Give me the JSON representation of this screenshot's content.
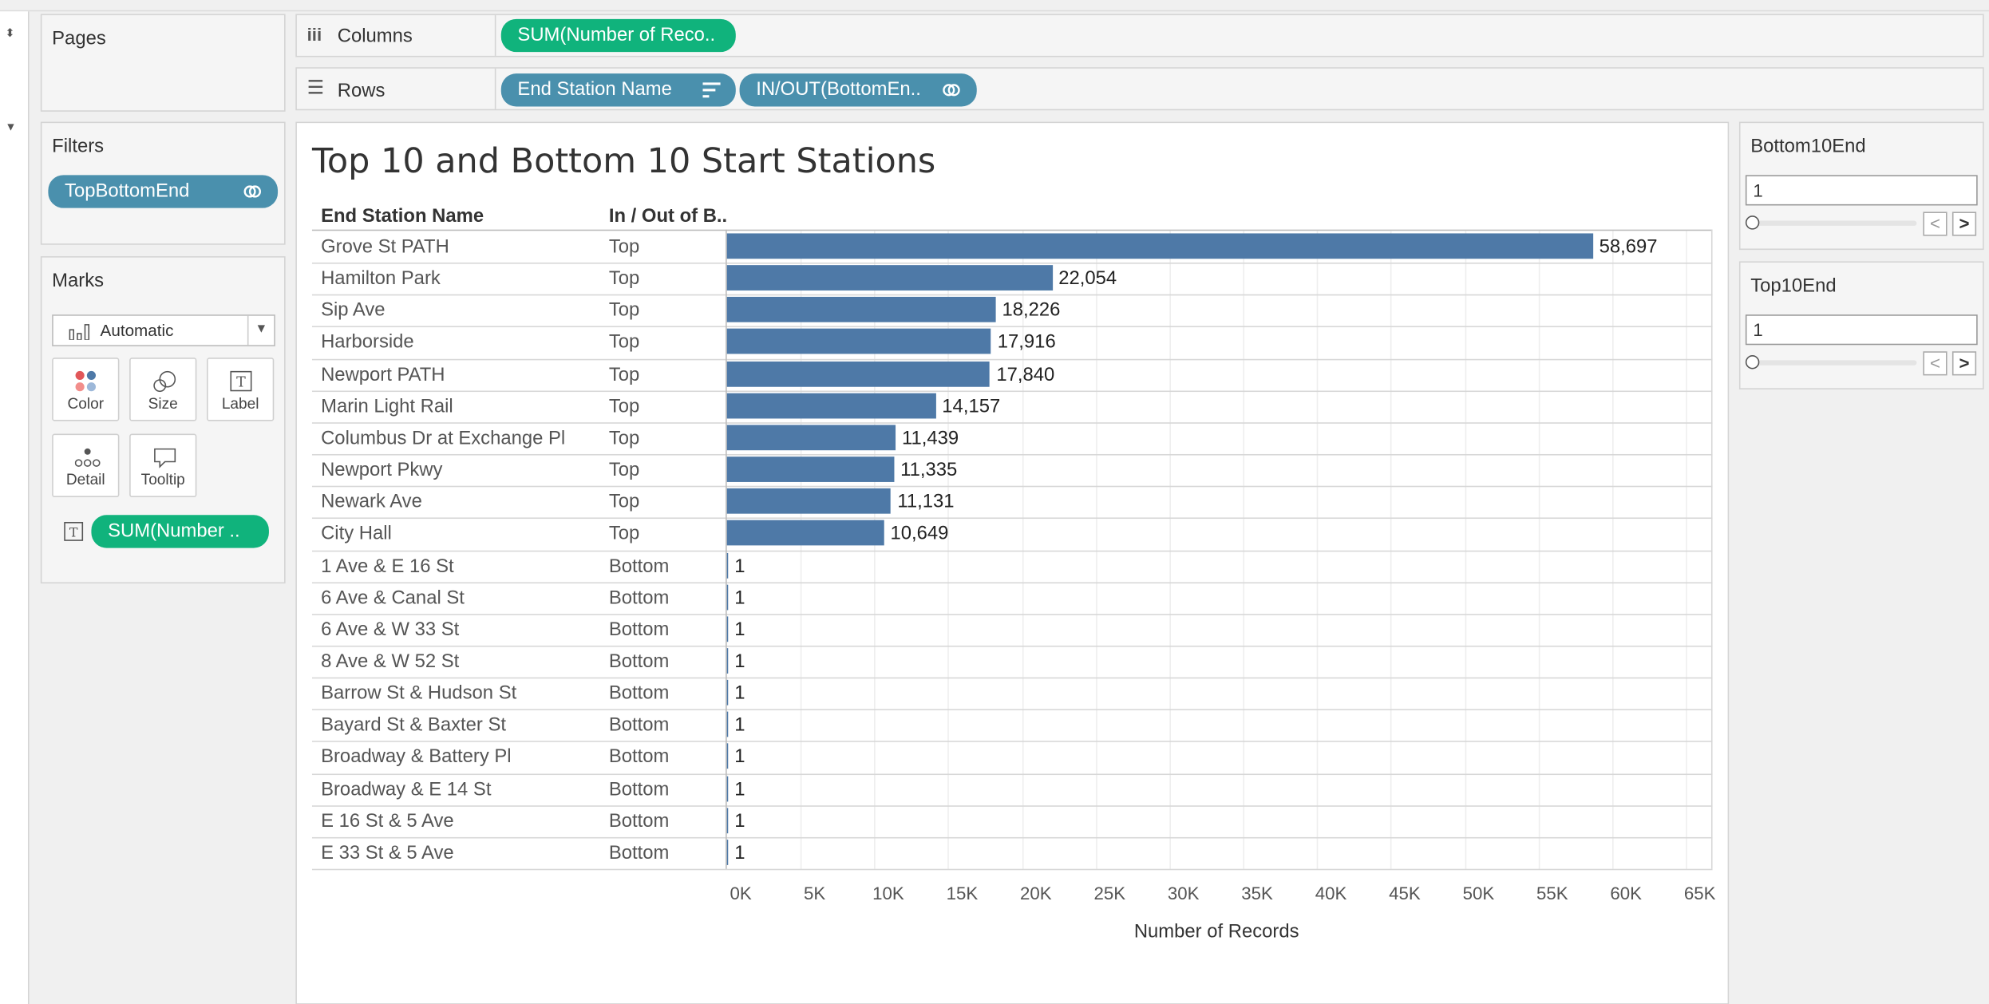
{
  "shelves": {
    "pages_title": "Pages",
    "columns_label": "Columns",
    "columns_pill": "SUM(Number of Reco..",
    "rows_label": "Rows",
    "rows_pills": [
      "End Station Name",
      "IN/OUT(BottomEn.."
    ]
  },
  "filters": {
    "title": "Filters",
    "pill": "TopBottomEnd"
  },
  "marks": {
    "title": "Marks",
    "type_select": "Automatic",
    "buttons": [
      "Color",
      "Size",
      "Label",
      "Detail",
      "Tooltip"
    ],
    "label_pill": "SUM(Number .."
  },
  "parameters": [
    {
      "title": "Bottom10End",
      "value": "1"
    },
    {
      "title": "Top10End",
      "value": "1"
    }
  ],
  "chart_data": {
    "type": "bar",
    "title": "Top 10 and Bottom 10 Start Stations",
    "row_headers": [
      "End Station Name",
      "In / Out of B.."
    ],
    "xlabel": "Number of Records",
    "xlim": [
      0,
      65000
    ],
    "ticks": [
      "0K",
      "5K",
      "10K",
      "15K",
      "20K",
      "25K",
      "30K",
      "35K",
      "40K",
      "45K",
      "50K",
      "55K",
      "60K",
      "65K"
    ],
    "bar_color": "#4e79a7",
    "categories": [
      "Grove St PATH",
      "Hamilton Park",
      "Sip Ave",
      "Harborside",
      "Newport PATH",
      "Marin Light Rail",
      "Columbus Dr at Exchange Pl",
      "Newport Pkwy",
      "Newark Ave",
      "City Hall",
      "1 Ave & E 16 St",
      "6 Ave & Canal St",
      "6 Ave & W 33 St",
      "8 Ave & W 52 St",
      "Barrow St & Hudson St",
      "Bayard St & Baxter St",
      "Broadway & Battery Pl",
      "Broadway & E 14 St",
      "E 16 St & 5 Ave",
      "E 33 St & 5 Ave"
    ],
    "groups": [
      "Top",
      "Top",
      "Top",
      "Top",
      "Top",
      "Top",
      "Top",
      "Top",
      "Top",
      "Top",
      "Bottom",
      "Bottom",
      "Bottom",
      "Bottom",
      "Bottom",
      "Bottom",
      "Bottom",
      "Bottom",
      "Bottom",
      "Bottom"
    ],
    "values": [
      58697,
      22054,
      18226,
      17916,
      17840,
      14157,
      11439,
      11335,
      11131,
      10649,
      1,
      1,
      1,
      1,
      1,
      1,
      1,
      1,
      1,
      1
    ],
    "labels": [
      "58,697",
      "22,054",
      "18,226",
      "17,916",
      "17,840",
      "14,157",
      "11,439",
      "11,335",
      "11,131",
      "10,649",
      "1",
      "1",
      "1",
      "1",
      "1",
      "1",
      "1",
      "1",
      "1",
      "1"
    ]
  }
}
